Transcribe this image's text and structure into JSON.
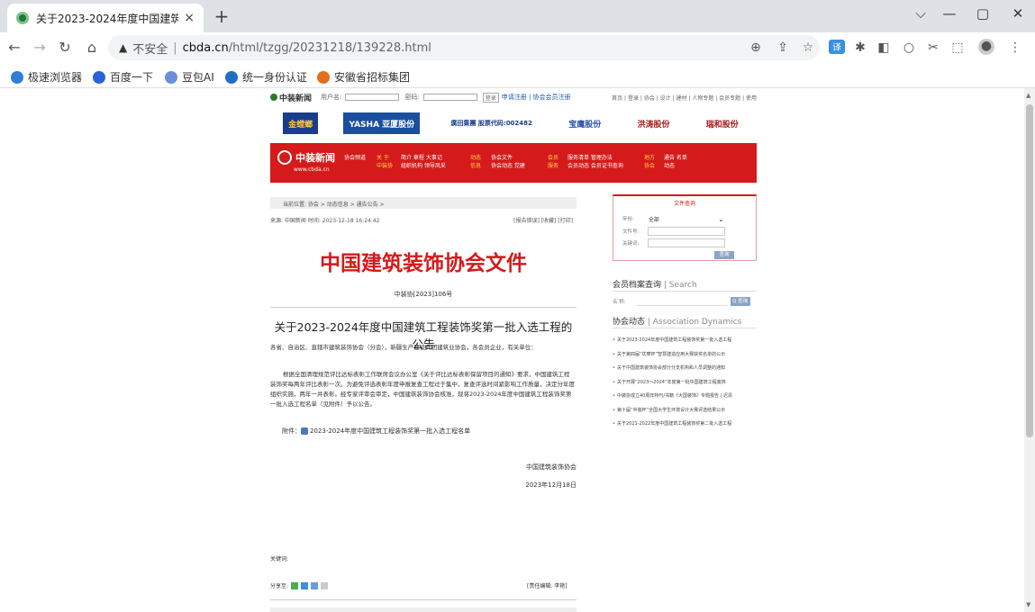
{
  "browser": {
    "tab_title": "关于2023-2024年度中国建筑工",
    "tab_close": "×",
    "new_tab": "+",
    "win_min": "—",
    "win_restore": "▢",
    "win_close": "✕",
    "chevron": "⌵",
    "url_warning": "▲",
    "url_insecure": "不安全",
    "url_host": "cbda.cn",
    "url_path": "/html/tzgg/20231218/139228.html",
    "bookmarks": [
      {
        "label": "极速浏览器",
        "color": "#2f7fd8"
      },
      {
        "label": "百度一下",
        "color": "#2b64d6"
      },
      {
        "label": "豆包AI",
        "color": "#6a8fd6"
      },
      {
        "label": "统一身份认证",
        "color": "#1f6fc6"
      },
      {
        "label": "安徽省招标集团",
        "color": "#e07020"
      }
    ]
  },
  "site": {
    "top_logo": "中装新闻",
    "user_label": "用户名:",
    "pwd_label": "密码:",
    "login_btn": "登录",
    "register_text": "申请注册 | 协会会员注册",
    "top_links": "首页 | 登录 | 协会 | 设计 | 建材 | 人物专题 | 会员专题 | 使用",
    "sponsors": [
      "金螳螂",
      "YASHA 亚厦股份",
      "廣田集團 股票代码:002482",
      "宝鹰股份",
      "洪涛股份",
      "瑞和股份"
    ],
    "red_logo": "中装新闻",
    "red_url": "www.cbda.cn",
    "red_nav": [
      {
        "l1": "协会频道",
        "l2": ""
      },
      {
        "l1": "关 于",
        "l2": "中装协"
      },
      {
        "l1": "简介 章程 大事记",
        "l2": "组织机构 领导风采"
      },
      {
        "l1": "动态",
        "l2": "信息"
      },
      {
        "l1": "协会文件",
        "l2": "协会动态 党建"
      },
      {
        "l1": "会员",
        "l2": "服务"
      },
      {
        "l1": "服务清单 管理办法",
        "l2": "会员动态 会员证书查询"
      },
      {
        "l1": "地方",
        "l2": "协会"
      },
      {
        "l1": "通告 名单",
        "l2": "动态"
      }
    ]
  },
  "article": {
    "breadcrumb": "当前位置: 协会 > 动态信息 > 通告公告 >",
    "source": "来源: 中国新闻  时间: 2023-12-18 16:24:42",
    "actions": "[报告错误] [收藏] [打印]",
    "doc_header": "中国建筑装饰协会文件",
    "doc_number": "中装协[2023]106号",
    "title": "关于2023-2024年度中国建筑工程装饰奖第一批入选工程的公告",
    "salutation": "各省、自治区、直辖市建筑装饰协会（分会），新疆生产建设兵团建筑业协会，各会员企业，有关单位：",
    "body": "根据全国清理规范评比达标表彰工作联席会议办公室《关于评比达标表彰保留项目的通知》要求，中国建筑工程装饰奖每两年评比表彰一次。为避免评选表彰年度申报复查工程过于集中，复查评选时间紧影响工作质量，决定分年度组织实施，两年一并表彰。经专家评审会审定，中国建筑装饰协会核准，现将2023-2024年度中国建筑工程装饰奖第一批入选工程名单（见附件）予以公告。",
    "attachment_prefix": "附件：",
    "attachment": "2023-2024年度中国建筑工程装饰奖第一批入选工程名单",
    "signer": "中国建筑装饰协会",
    "date": "2023年12月18日",
    "keywords": "关键词:",
    "share": "分享至:",
    "editor": "[责任编辑: 李艳]"
  },
  "sidebar": {
    "file_query_title": "文件查询",
    "f_label1": "年份:",
    "f_value1": "全部",
    "f_label2": "文件号:",
    "f_label3": "关键词:",
    "f_btn": "查询",
    "member_title": "会员档案查询",
    "member_en": "Search",
    "member_label": "名  称:",
    "member_btn": "Q 查询",
    "dyn_title": "协会动态",
    "dyn_en": "Association Dynamics",
    "dyn_items": [
      "关于2023-2024年度中国建筑工程装饰奖第一批入选工程",
      "关于第四届“优摩杯”智慧建造应用大赛获奖名单的公示",
      "关于中国建筑装饰协会部分分支机构和人员调整的通知",
      "关于开展“2023～2024”年度第一批中国建筑工程装饰",
      "中装协成立40周年特刊/书籍《大国装饰》专题报告 | 迟清",
      "第十届“中装杯”全国大学生环境设计大赛评选结果公示",
      "关于2021-2022年度中国建筑工程装饰奖第二批入选工程"
    ]
  }
}
